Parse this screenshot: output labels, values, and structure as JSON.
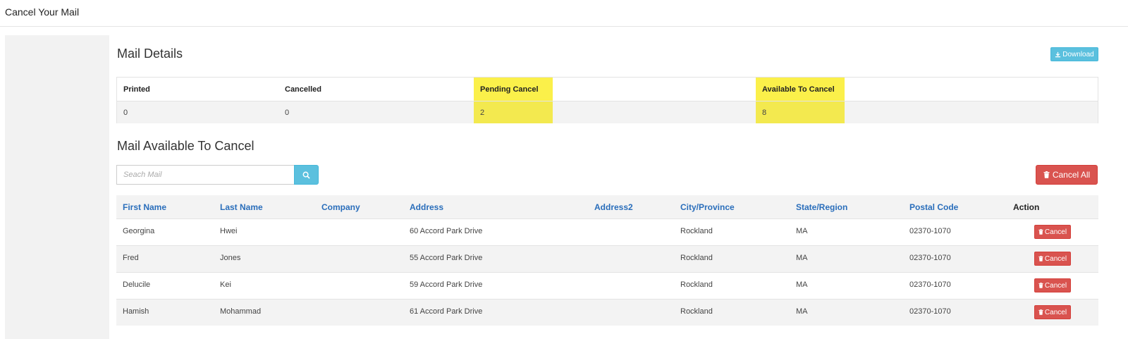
{
  "header": {
    "title": "Cancel Your Mail"
  },
  "mail_details": {
    "title": "Mail Details",
    "download_label": "Download",
    "stats": [
      {
        "label": "Printed",
        "value": "0"
      },
      {
        "label": "Cancelled",
        "value": "0"
      },
      {
        "label": "Pending Cancel",
        "value": "2"
      },
      {
        "label": "Available To Cancel",
        "value": "8"
      }
    ],
    "highlight_color": "#f3e94f"
  },
  "available": {
    "title": "Mail Available To Cancel",
    "search_placeholder": "Seach Mail",
    "cancel_all_label": "Cancel All",
    "columns": [
      "First Name",
      "Last Name",
      "Company",
      "Address",
      "Address2",
      "City/Province",
      "State/Region",
      "Postal Code",
      "Action"
    ],
    "row_cancel_label": "Cancel",
    "rows": [
      {
        "first": "Georgina",
        "last": "Hwei",
        "company": "",
        "address": "60 Accord Park Drive",
        "address2": "",
        "city": "Rockland",
        "state": "MA",
        "postal": "02370-1070"
      },
      {
        "first": "Fred",
        "last": "Jones",
        "company": "",
        "address": "55 Accord Park Drive",
        "address2": "",
        "city": "Rockland",
        "state": "MA",
        "postal": "02370-1070"
      },
      {
        "first": "Delucile",
        "last": "Kei",
        "company": "",
        "address": "59 Accord Park Drive",
        "address2": "",
        "city": "Rockland",
        "state": "MA",
        "postal": "02370-1070"
      },
      {
        "first": "Hamish",
        "last": "Mohammad",
        "company": "",
        "address": "61 Accord Park Drive",
        "address2": "",
        "city": "Rockland",
        "state": "MA",
        "postal": "02370-1070"
      }
    ]
  },
  "colors": {
    "info": "#5bc0de",
    "danger": "#d9534f",
    "link": "#2a6ebb"
  }
}
